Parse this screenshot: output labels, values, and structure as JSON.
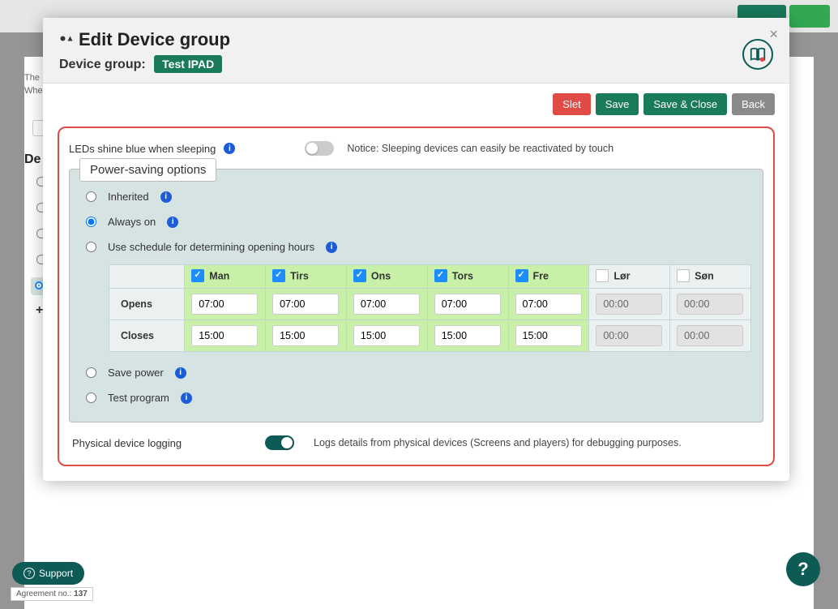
{
  "header": {
    "title": "Edit Device group",
    "subtitle_prefix": "Device group:",
    "badge": "Test IPAD"
  },
  "actions": {
    "delete": "Slet",
    "save": "Save",
    "save_close": "Save & Close",
    "back": "Back"
  },
  "leds": {
    "label": "LEDs shine blue when sleeping",
    "notice": "Notice: Sleeping devices can easily be reactivated by touch"
  },
  "power_section": {
    "legend": "Power-saving options",
    "options": {
      "inherited": "Inherited",
      "always_on": "Always on",
      "schedule": "Use schedule for determining opening hours",
      "save_power": "Save power",
      "test_program": "Test program"
    }
  },
  "schedule": {
    "rows": {
      "opens": "Opens",
      "closes": "Closes"
    },
    "days": [
      {
        "key": "man",
        "label": "Man",
        "enabled": true,
        "opens": "07:00",
        "closes": "15:00"
      },
      {
        "key": "tirs",
        "label": "Tirs",
        "enabled": true,
        "opens": "07:00",
        "closes": "15:00"
      },
      {
        "key": "ons",
        "label": "Ons",
        "enabled": true,
        "opens": "07:00",
        "closes": "15:00"
      },
      {
        "key": "tors",
        "label": "Tors",
        "enabled": true,
        "opens": "07:00",
        "closes": "15:00"
      },
      {
        "key": "fre",
        "label": "Fre",
        "enabled": true,
        "opens": "07:00",
        "closes": "15:00"
      },
      {
        "key": "lor",
        "label": "Lør",
        "enabled": false,
        "opens": "00:00",
        "closes": "00:00"
      },
      {
        "key": "son",
        "label": "Søn",
        "enabled": false,
        "opens": "00:00",
        "closes": "00:00"
      }
    ]
  },
  "logging": {
    "label": "Physical device logging",
    "desc": "Logs details from physical devices (Screens and players) for debugging purposes."
  },
  "support": {
    "label": "Support",
    "help": "?",
    "agreement_prefix": "Agreement no.:",
    "agreement_no": "137"
  },
  "bg": {
    "de_label": "De",
    "the": "The",
    "whe": "Whe"
  }
}
